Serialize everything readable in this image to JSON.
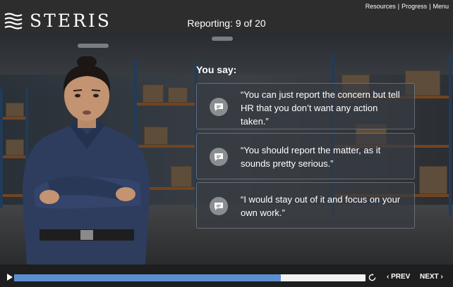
{
  "header": {
    "brand": "STERIS",
    "title": "Reporting: 9 of 20",
    "links": {
      "resources": "Resources",
      "progress": "Progress",
      "menu": "Menu",
      "separator": "|"
    }
  },
  "main": {
    "prompt": "You say:",
    "options": [
      {
        "text": "“You can just report the concern but tell HR that you don’t want any action taken.”"
      },
      {
        "text": "“You should report the matter, as it sounds pretty serious.”"
      },
      {
        "text": "“I would stay out of it and focus on your own work.”"
      }
    ]
  },
  "footer": {
    "progress": 0.76,
    "prev_label": "PREV",
    "next_label": "NEXT",
    "prev_icon": "chevron-left-icon",
    "next_icon": "chevron-right-icon",
    "play_icon": "play-icon",
    "replay_icon": "replay-icon"
  },
  "colors": {
    "accent": "#5b8fd1",
    "header_bg": "#2d2d2d",
    "footer_bg": "#1e1e1e"
  }
}
